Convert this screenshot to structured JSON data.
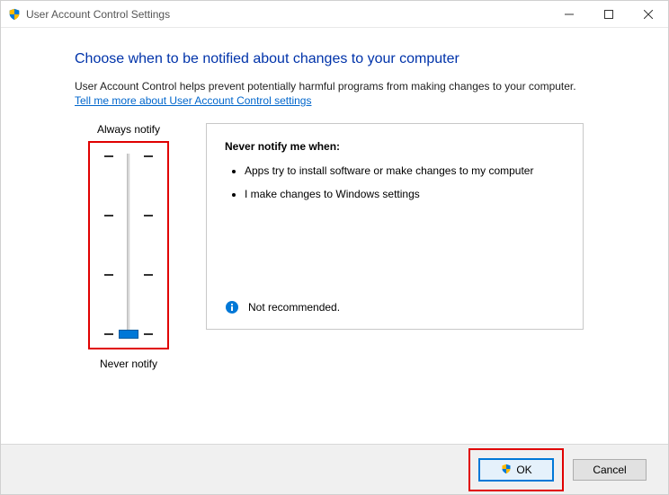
{
  "window": {
    "title": "User Account Control Settings"
  },
  "content": {
    "heading": "Choose when to be notified about changes to your computer",
    "description": "User Account Control helps prevent potentially harmful programs from making changes to your computer.",
    "help_link": "Tell me more about User Account Control settings"
  },
  "slider": {
    "top_label": "Always notify",
    "bottom_label": "Never notify",
    "level": 0,
    "levels_total": 4
  },
  "panel": {
    "title": "Never notify me when:",
    "bullets": [
      "Apps try to install software or make changes to my computer",
      "I make changes to Windows settings"
    ],
    "footer_text": "Not recommended."
  },
  "buttons": {
    "ok": "OK",
    "cancel": "Cancel"
  },
  "icons": {
    "shield": "shield-icon",
    "info": "info-icon",
    "minimize": "minimize-icon",
    "maximize": "maximize-icon",
    "close": "close-icon"
  }
}
